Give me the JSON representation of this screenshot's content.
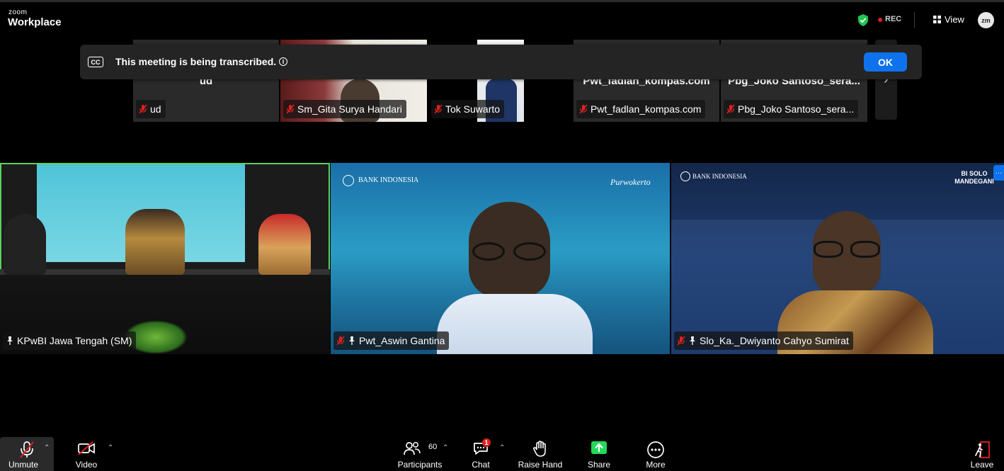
{
  "app": {
    "brand_small": "zoom",
    "brand_large": "Workplace"
  },
  "header": {
    "rec_label": "REC",
    "view_label": "View",
    "avatar_initials": "zm"
  },
  "banner": {
    "message": "This meeting is being transcribed.",
    "ok_label": "OK",
    "cc_label": "CC"
  },
  "thumbnails": [
    {
      "name": "ud",
      "big_name": "ud"
    },
    {
      "name": "Sm_Gita Surya Handari"
    },
    {
      "name": "Tok Suwarto"
    },
    {
      "name": "Pwt_fadlan_kompas.com",
      "big_name": "Pwt_fadlan_kompas.com"
    },
    {
      "name": "Pbg_Joko Santoso_sera...",
      "big_name": "Pbg_Joko Santoso_sera..."
    }
  ],
  "videos": [
    {
      "name": "KPwBI Jawa Tengah (SM)"
    },
    {
      "name": "Pwt_Aswin Gantina",
      "bg_text_left": "BANK INDONESIA",
      "bg_text_right": "Purwokerto"
    },
    {
      "name": "Slo_Ka._Dwiyanto Cahyo Sumirat",
      "bg_text_left": "BANK INDONESIA",
      "bg_text_right": "BI SOLO MANDEGANI"
    }
  ],
  "toolbar": {
    "unmute": "Unmute",
    "video": "Video",
    "participants": "Participants",
    "participants_count": "60",
    "chat": "Chat",
    "chat_badge": "1",
    "raise_hand": "Raise Hand",
    "share": "Share",
    "more": "More",
    "leave": "Leave"
  },
  "colors": {
    "accent": "#0e72ed",
    "muted_red": "#e02020",
    "active_speaker": "#5ad05a",
    "share_green": "#23d959"
  }
}
